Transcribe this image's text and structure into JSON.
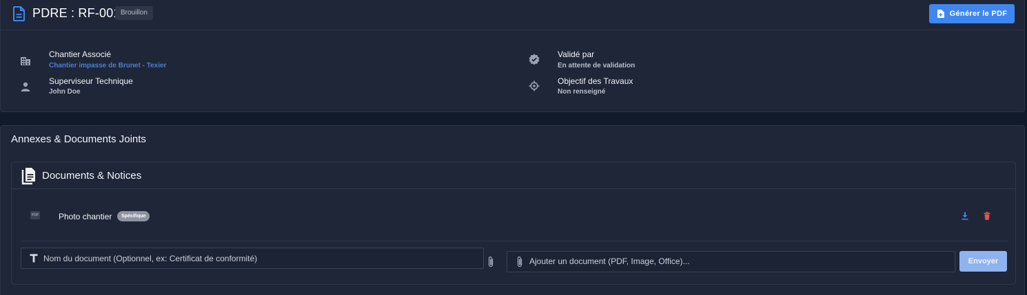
{
  "header": {
    "title": "PDRE : RF-001",
    "status": "Brouillon",
    "pdf_button": "Générer le PDF"
  },
  "info": {
    "chantier_label": "Chantier Associé",
    "chantier_value": "Chantier impasse de Brunet - Texier",
    "superviseur_label": "Superviseur Technique",
    "superviseur_value": "John Doe",
    "valide_label": "Validé par",
    "valide_value": "En attente de validation",
    "objectif_label": "Objectif des Travaux",
    "objectif_value": "Non renseigné"
  },
  "annexes": {
    "title": "Annexes & Documents Joints",
    "section_title": "Documents & Notices",
    "documents": [
      {
        "name": "Photo chantier",
        "tag": "Spécifique",
        "file_icon": "PDF"
      }
    ],
    "name_placeholder": "Nom du document (Optionnel, ex: Certificat de conformité)",
    "upload_placeholder": "Ajouter un document (PDF, Image, Office)...",
    "send_button": "Envoyer"
  },
  "colors": {
    "accent": "#3e87f0",
    "link": "#4a7fd4",
    "danger": "#e5534b",
    "background": "#111a2b",
    "card": "#1f2638"
  }
}
